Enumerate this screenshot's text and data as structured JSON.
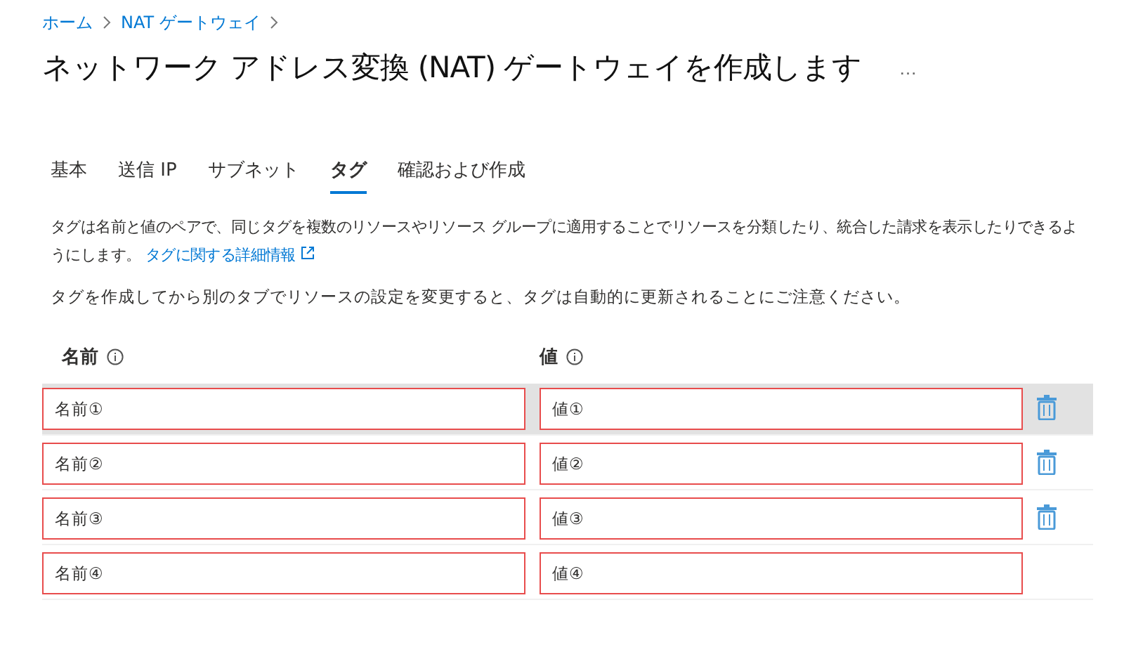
{
  "breadcrumb": [
    "ホーム",
    "NAT ゲートウェイ"
  ],
  "title": "ネットワーク アドレス変換 (NAT) ゲートウェイを作成します",
  "more": "…",
  "tabs": [
    {
      "label": "基本",
      "selected": false
    },
    {
      "label": "送信 IP",
      "selected": false
    },
    {
      "label": "サブネット",
      "selected": false
    },
    {
      "label": "タグ",
      "selected": true
    },
    {
      "label": "確認および作成",
      "selected": false
    }
  ],
  "description": "タグは名前と値のペアで、同じタグを複数のリソースやリソース グループに適用することでリソースを分類したり、統合した請求を表示したりできるようにします。",
  "link": "タグに関する詳細情報",
  "note": "タグを作成してから別のタブでリソースの設定を変更すると、タグは自動的に更新されることにご注意ください。",
  "columns": [
    "名前",
    "値"
  ],
  "rows": [
    {
      "name": "名前①",
      "value": "値①",
      "highlighted": true,
      "deletable": true
    },
    {
      "name": "名前②",
      "value": "値②",
      "highlighted": false,
      "deletable": true
    },
    {
      "name": "名前③",
      "value": "値③",
      "highlighted": false,
      "deletable": true
    },
    {
      "name": "名前④",
      "value": "値④",
      "highlighted": false,
      "deletable": false
    }
  ]
}
